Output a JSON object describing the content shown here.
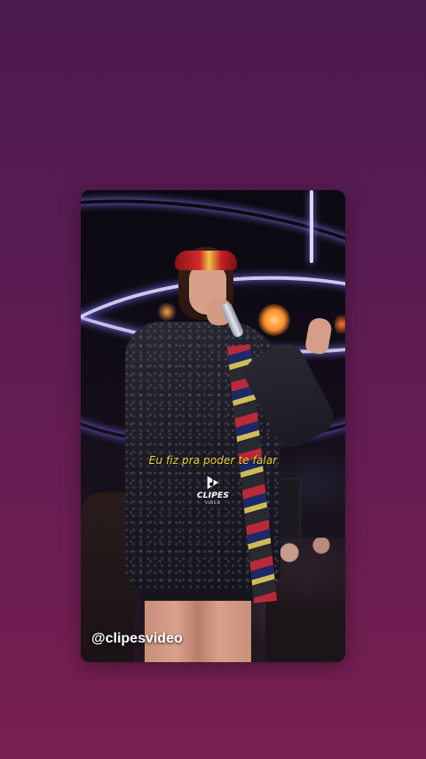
{
  "story": {
    "lyric": "Eu fiz pra poder te falar",
    "handle": "@clipesvideo"
  },
  "logo": {
    "name": "clipes-video-logo",
    "wordmark": "CLIPES",
    "subtitle": "VIDEO"
  },
  "colors": {
    "background_top": "#4b1a4f",
    "background_bottom": "#771f50",
    "lyric_text": "#f2d233",
    "handle_text": "#ffffff"
  }
}
